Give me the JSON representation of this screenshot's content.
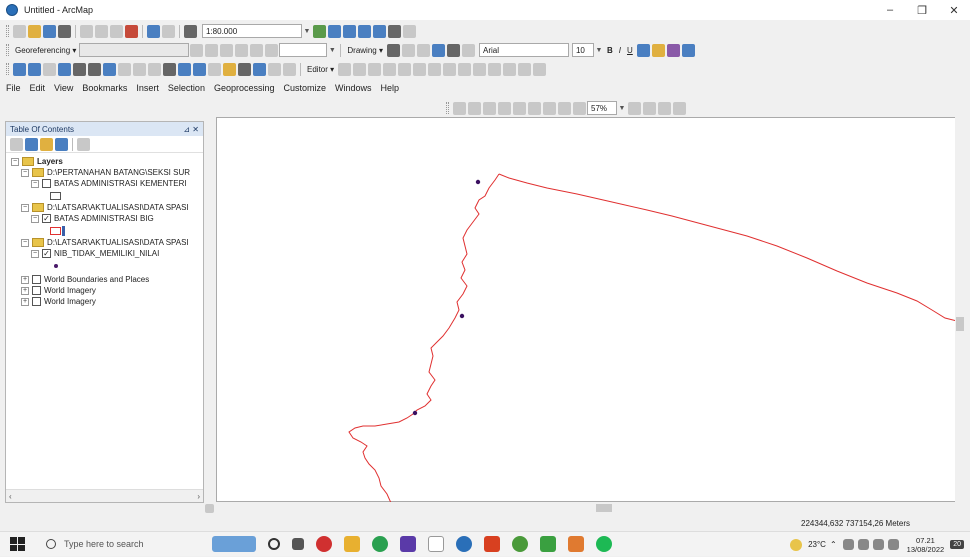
{
  "window": {
    "title": "Untitled - ArcMap",
    "minimize_glyph": "–",
    "maximize_glyph": "❐",
    "close_glyph": "✕"
  },
  "toolbar": {
    "scale": "1:80.000",
    "georeferencing": "Georeferencing ▾",
    "drawing": "Drawing ▾",
    "font": "Arial",
    "font_size": "10",
    "bold": "B",
    "italic": "I",
    "underline": "U",
    "editor": "Editor ▾",
    "zoom_percent": "57%"
  },
  "menu": [
    "File",
    "Edit",
    "View",
    "Bookmarks",
    "Insert",
    "Selection",
    "Geoprocessing",
    "Customize",
    "Windows",
    "Help"
  ],
  "toc": {
    "title": "Table Of Contents",
    "pin_close": "⊿ ✕",
    "layers_label": "Layers",
    "items": [
      {
        "label": "D:\\PERTANAHAN BATANG\\SEKSI SUR"
      },
      {
        "label": "BATAS ADMINISTRASI KEMENTERI"
      },
      {
        "label": "D:\\LATSAR\\AKTUALISASI\\DATA SPASI"
      },
      {
        "label": "BATAS ADMINISTRASI BIG"
      },
      {
        "label": "D:\\LATSAR\\AKTUALISASI\\DATA SPASI"
      },
      {
        "label": "NIB_TIDAK_MEMILIKI_NILAI"
      },
      {
        "label": "World Boundaries and Places"
      },
      {
        "label": "World Imagery"
      },
      {
        "label": "World Imagery"
      }
    ]
  },
  "map": {
    "boundary_color": "#e03030",
    "point_color": "#3a1060"
  },
  "status": {
    "coordinates": "224344,632  737154,26 Meters"
  },
  "taskbar": {
    "search_placeholder": "Type here to search",
    "weather": "23°C",
    "time": "07.21",
    "date": "13/08/2022",
    "notification_count": "20"
  }
}
